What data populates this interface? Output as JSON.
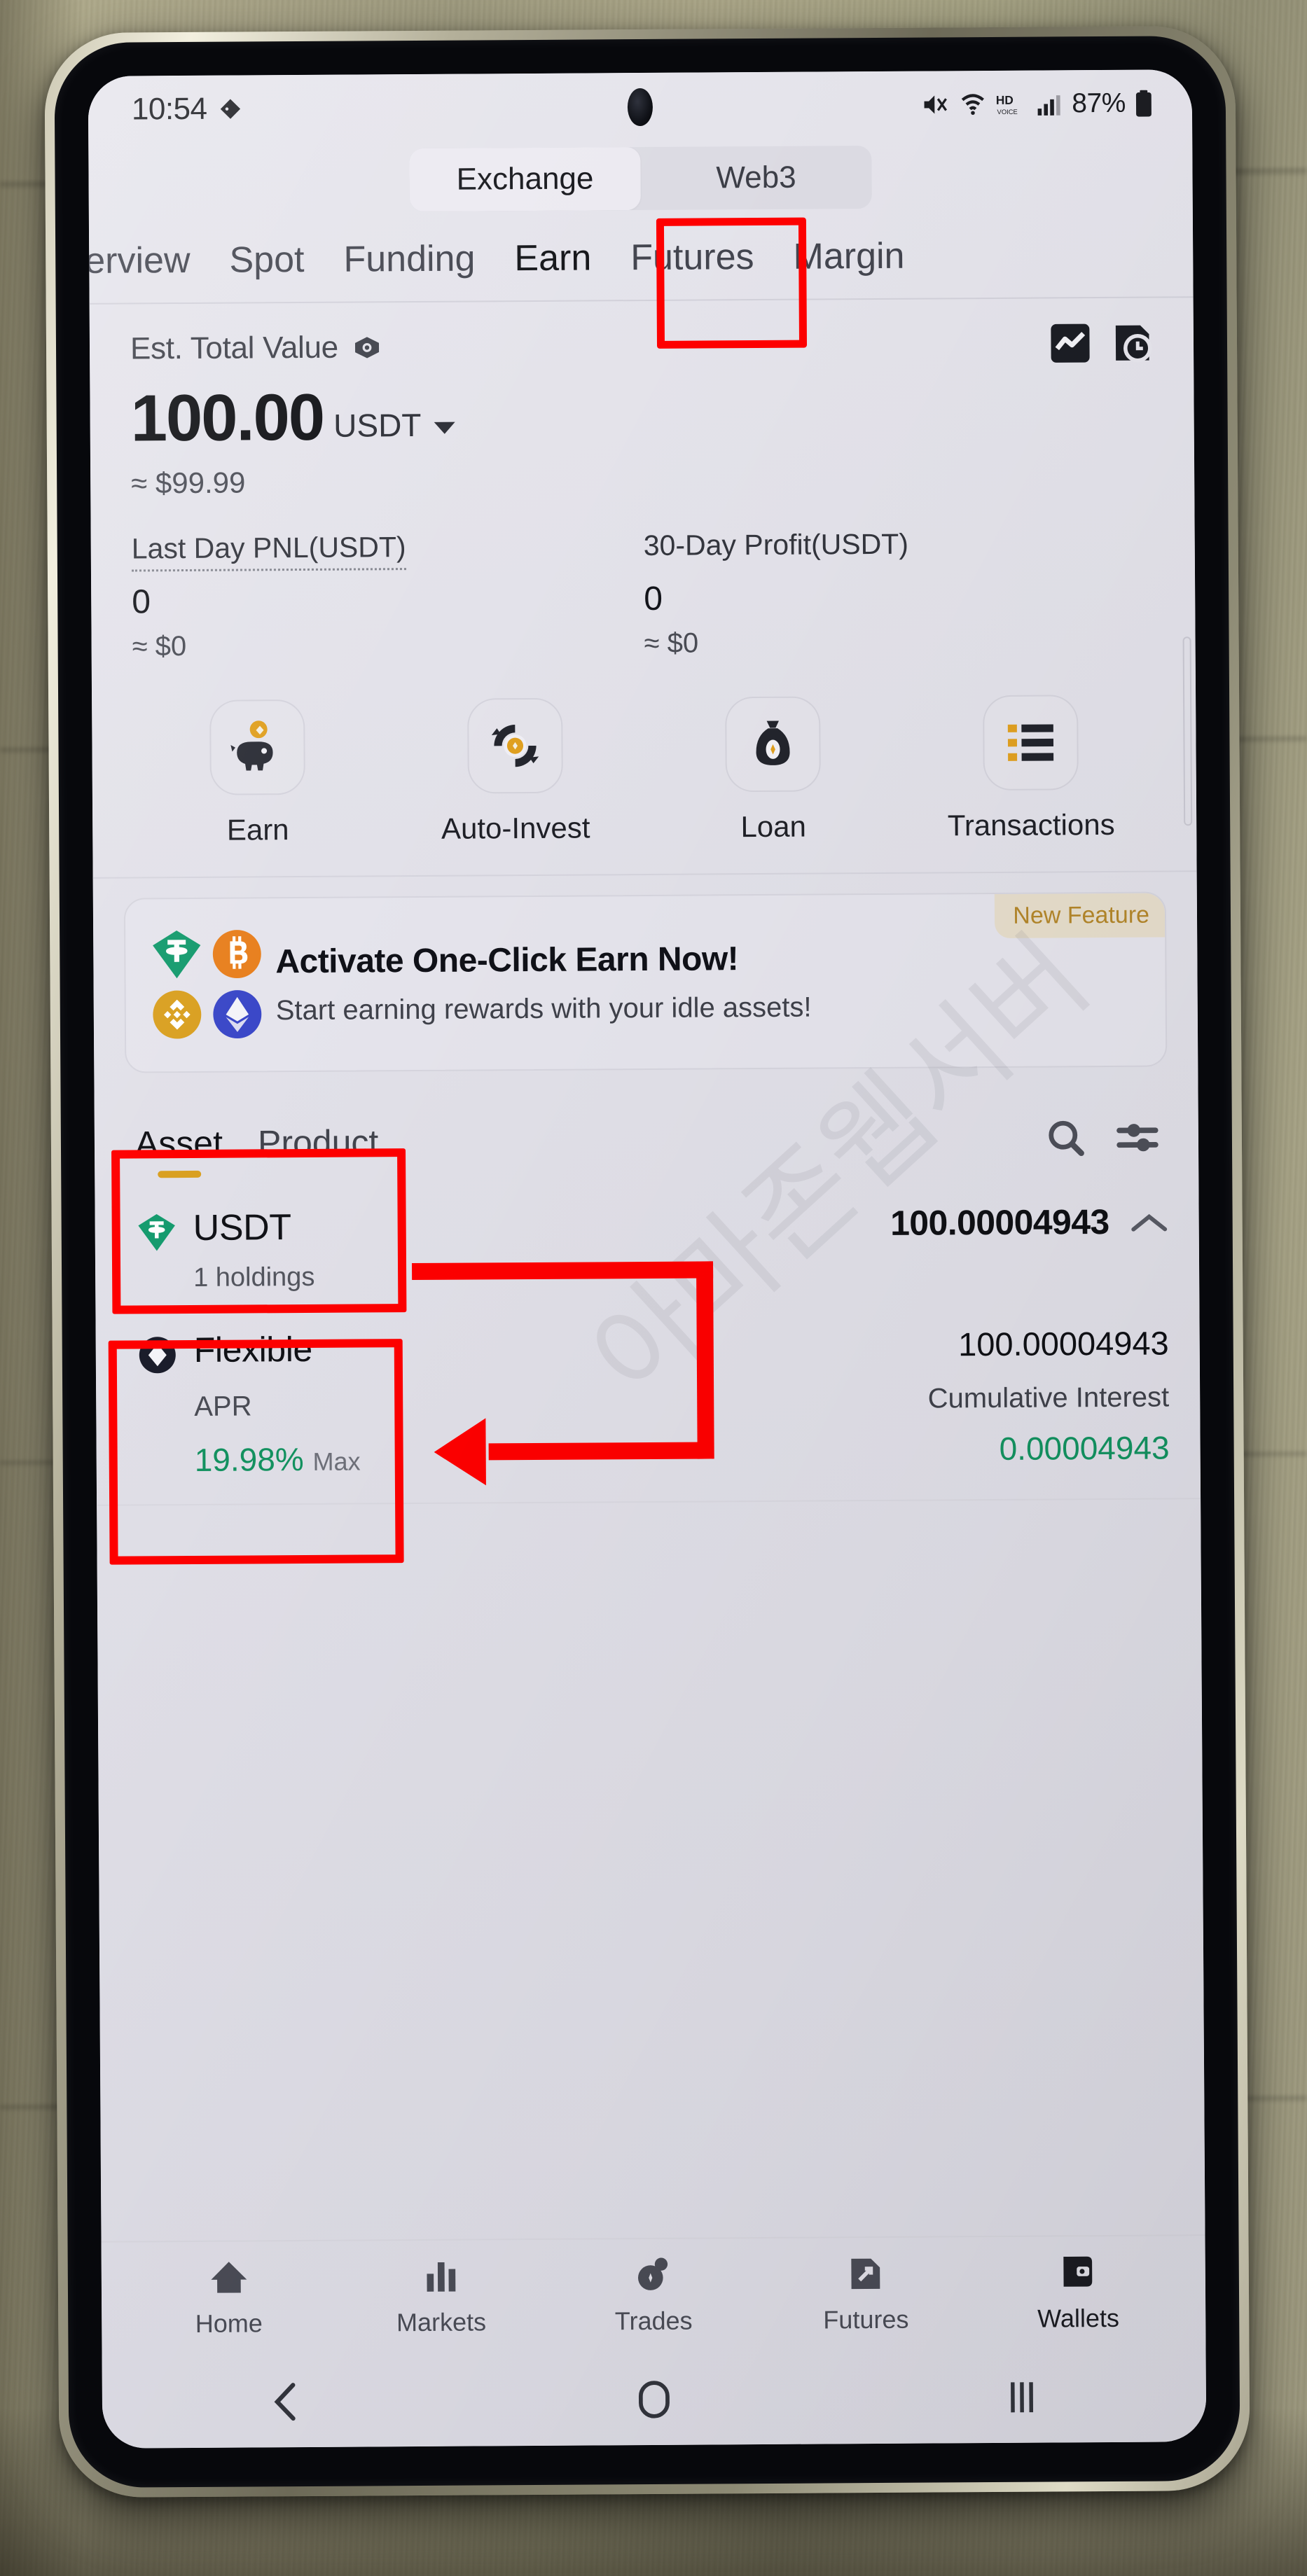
{
  "status_bar": {
    "time": "10:54",
    "battery_percent": "87%",
    "icons": [
      "tag-icon",
      "volume-mute-icon",
      "wifi-icon",
      "hd-voice-icon",
      "signal-bars-icon",
      "battery-icon"
    ]
  },
  "top_segment": {
    "items": [
      {
        "label": "Exchange",
        "active": true
      },
      {
        "label": "Web3",
        "active": false
      }
    ]
  },
  "main_tabs": {
    "items": [
      {
        "label": "verview",
        "selected": false
      },
      {
        "label": "Spot",
        "selected": false
      },
      {
        "label": "Funding",
        "selected": false
      },
      {
        "label": "Earn",
        "selected": true
      },
      {
        "label": "Futures",
        "selected": false
      },
      {
        "label": "Margin",
        "selected": false
      }
    ]
  },
  "balance": {
    "label": "Est. Total Value",
    "eye_icon": "eye-icon",
    "amount": "100.00",
    "unit": "USDT",
    "usd_approx": "≈ $99.99",
    "header_icons": [
      "analytics-chart-icon",
      "history-document-icon"
    ]
  },
  "pnl": {
    "last_day": {
      "label": "Last Day PNL(USDT)",
      "value": "0",
      "usd": "≈ $0"
    },
    "thirty_day": {
      "label": "30-Day Profit(USDT)",
      "value": "0",
      "usd": "≈ $0"
    }
  },
  "quick_actions": [
    {
      "label": "Earn",
      "icon": "piggy-bank-icon"
    },
    {
      "label": "Auto-Invest",
      "icon": "auto-invest-refresh-icon"
    },
    {
      "label": "Loan",
      "icon": "money-bag-icon"
    },
    {
      "label": "Transactions",
      "icon": "list-lines-icon"
    }
  ],
  "promo": {
    "badge": "New Feature",
    "title": "Activate One-Click Earn Now!",
    "subtitle": "Start earning rewards with your idle assets!",
    "coin_icons": [
      "usdt-tether-icon",
      "bitcoin-icon",
      "bnb-icon",
      "ethereum-icon"
    ]
  },
  "sub_tabs": {
    "items": [
      {
        "label": "Asset",
        "active": true
      },
      {
        "label": "Product",
        "active": false
      }
    ],
    "icons": [
      "search-icon",
      "filter-sliders-icon"
    ]
  },
  "assets": [
    {
      "name": "USDT",
      "icon": "usdt-tether-icon",
      "holdings": "1 holdings",
      "amount": "100.00004943",
      "expand_icon": "chevron-up-icon",
      "children": [
        {
          "name": "Flexible",
          "icon": "flexible-diamond-icon",
          "apr_label": "APR",
          "apr_value": "19.98%",
          "apr_suffix": "Max",
          "amount": "100.00004943",
          "cumulative_label": "Cumulative Interest",
          "cumulative_value": "0.00004943"
        }
      ]
    }
  ],
  "bottom_nav": {
    "items": [
      {
        "label": "Home",
        "icon": "home-icon",
        "active": false
      },
      {
        "label": "Markets",
        "icon": "markets-bars-icon",
        "active": false
      },
      {
        "label": "Trades",
        "icon": "trades-icon",
        "active": false
      },
      {
        "label": "Futures",
        "icon": "futures-icon",
        "active": false
      },
      {
        "label": "Wallets",
        "icon": "wallets-icon",
        "active": true
      }
    ]
  },
  "system_nav": {
    "buttons": [
      "back-chevron-icon",
      "home-circle-icon",
      "recents-bars-icon"
    ]
  },
  "watermark": {
    "text": "아마존웹서버"
  },
  "colors": {
    "screen_bg": "#e2e1e9",
    "accent_gold": "#d9a021",
    "green_positive": "#139260",
    "annotation_red": "#fe0000",
    "badge_text": "#b3862a",
    "text_primary": "#111217",
    "text_secondary": "#4a4c55"
  }
}
